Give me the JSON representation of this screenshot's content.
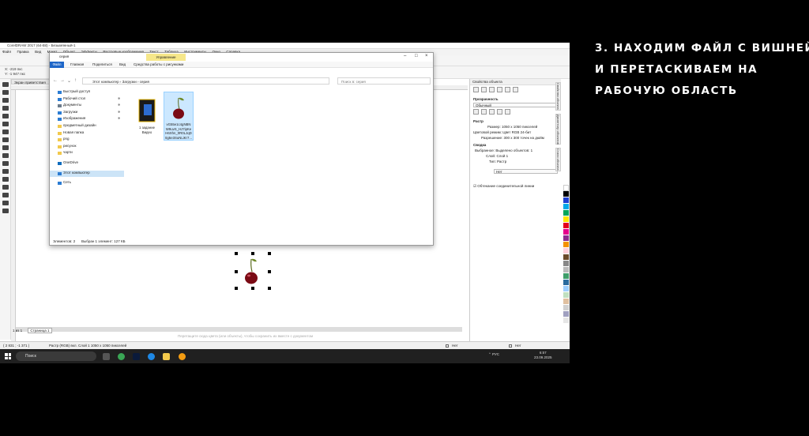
{
  "caption": {
    "line1": "3. НАХОДИМ ФАЙЛ С ВИШНЕЙ",
    "line2": "И ПЕРЕТАСКИВАЕМ НА",
    "line3": "РАБОЧУЮ ОБЛАСТЬ"
  },
  "app": {
    "title": "CorelDRAW 2017 (64-Bit) - Безымянный-1",
    "menu": [
      "Файл",
      "Правка",
      "Вид",
      "Макет",
      "Объект",
      "Эффекты",
      "Растровые изображения",
      "Текст",
      "Таблица",
      "Инструменты",
      "Окно",
      "Справка"
    ],
    "coord_x": "X: -219 пкс",
    "coord_y": "Y: -1 947 пкс",
    "dock_tab": "Экран приветствия",
    "page_nav": "1 из 1",
    "page_tab": "Страница 1",
    "hint": "Перетащите сюда цвета (или объекты), чтобы сохранить их вместе с документом",
    "status_coords": "( 2 831 ; -1 371 )",
    "status_object": "Растр (RGB) вкл. Слой 1 1050 x 1050 пикселей",
    "status_fill_none": "Нет",
    "status_outline_none": "Нет"
  },
  "docker": {
    "title": "Свойства объекта",
    "transparency_label": "Прозрачность",
    "transparency_mode": "Обычный",
    "bitmap_section": "Растр",
    "size_label": "Размер:",
    "size_value": "1050 x 1050 пикселей",
    "color_mode_label": "Цветовой режим:",
    "color_mode_value": "Цвет RGB 24-бит",
    "resolution_label": "Разрешение:",
    "resolution_value": "300 x 300 точек на дюйм",
    "summary_section": "Сводка",
    "selected_label": "Выбранное:",
    "selected_value": "Выделено объектов: 1",
    "layer_label": "Слой:",
    "layer_value": "Слой 1",
    "type_label": "Тип:",
    "type_value": "Растр",
    "wrap_value": "Нет",
    "connector_label": "Обтекание соединительной линии",
    "side_tabs": [
      "Свойства объекта",
      "Диспетчер объектов",
      "Стили объекта"
    ]
  },
  "explorer": {
    "title": "серия",
    "manage_tab": "Управление",
    "ribbon": [
      "Файл",
      "Главная",
      "Поделиться",
      "Вид",
      "Средства работы с рисунками"
    ],
    "breadcrumb": [
      "Этот компьютер",
      "Загрузки",
      "серия"
    ],
    "search_placeholder": "Поиск в: серия",
    "nav_items": [
      {
        "label": "Быстрый доступ",
        "icon": "star-icon",
        "color": "#2b7cd3",
        "pinned": false
      },
      {
        "label": "Рабочий стол",
        "icon": "desktop-icon",
        "color": "#2b7cd3",
        "pinned": true
      },
      {
        "label": "Документы",
        "icon": "documents-icon",
        "color": "#6b7b8c",
        "pinned": true
      },
      {
        "label": "Загрузки",
        "icon": "downloads-icon",
        "color": "#2b7cd3",
        "pinned": true
      },
      {
        "label": "Изображения",
        "icon": "pictures-icon",
        "color": "#2b7cd3",
        "pinned": true
      },
      {
        "label": "предметный дизайн",
        "icon": "folder-icon",
        "color": "#f2c94c",
        "pinned": false
      },
      {
        "label": "Новая папка",
        "icon": "folder-icon",
        "color": "#f2c94c",
        "pinned": false
      },
      {
        "label": "png",
        "icon": "folder-icon",
        "color": "#f2c94c",
        "pinned": false
      },
      {
        "label": "рисунок",
        "icon": "folder-icon",
        "color": "#f2c94c",
        "pinned": false
      },
      {
        "label": "чарти",
        "icon": "folder-icon",
        "color": "#f2c94c",
        "pinned": false
      },
      {
        "label": "",
        "icon": "spacer",
        "color": "",
        "pinned": false
      },
      {
        "label": "OneDrive",
        "icon": "onedrive-icon",
        "color": "#0f6cbd",
        "pinned": false
      },
      {
        "label": "",
        "icon": "spacer",
        "color": "",
        "pinned": false
      },
      {
        "label": "Этот компьютер",
        "icon": "computer-icon",
        "color": "#2b7cd3",
        "pinned": false
      },
      {
        "label": "",
        "icon": "spacer",
        "color": "",
        "pinned": false
      },
      {
        "label": "Сеть",
        "icon": "network-icon",
        "color": "#2b7cd3",
        "pinned": false
      }
    ],
    "files": [
      {
        "name_line1": "1 задание",
        "name_line2": "Видео",
        "name_line3": "",
        "name_line4": "",
        "icon": "video-file-icon"
      },
      {
        "name_line1": "vG55e1c4gNBN",
        "name_line2": "W9uvS_HJ7ipKe",
        "name_line3": "H6Xhn_0R0LJqD",
        "name_line4": "0g5e3SuNLiKr7...",
        "icon": "cherry-image-icon"
      }
    ],
    "status_count": "Элементов: 2",
    "status_selected": "Выбран 1 элемент: 127 КБ"
  },
  "taskbar": {
    "search": "Поиск",
    "lang": "РУС",
    "time": "6:57",
    "date": "23.09.2025"
  },
  "colors": {
    "explorer_file_tab": "#1e66c8",
    "manage_tab": "#f6e78a",
    "selection": "#cce8ff",
    "cherry": "#7a0a14",
    "taskbar": "#202020"
  }
}
